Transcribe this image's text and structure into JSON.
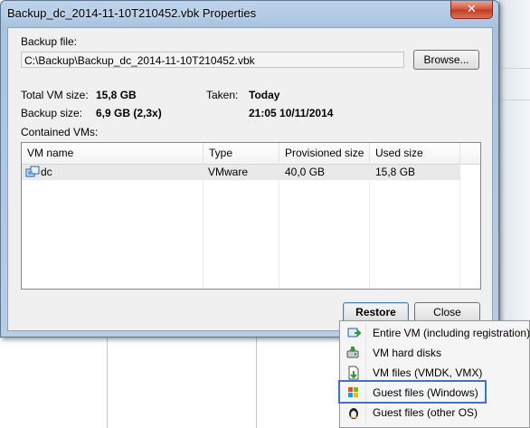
{
  "window": {
    "title": "Backup_dc_2014-11-10T210452.vbk Properties",
    "close_glyph": "✕"
  },
  "backup_file": {
    "label": "Backup file:",
    "path": "C:\\Backup\\Backup_dc_2014-11-10T210452.vbk",
    "browse_label": "Browse..."
  },
  "stats": {
    "total_vm_size_label": "Total VM size:",
    "total_vm_size_value": "15,8 GB",
    "backup_size_label": "Backup size:",
    "backup_size_value": "6,9 GB (2,3x)",
    "taken_label": "Taken:",
    "taken_day": "Today",
    "taken_time": "21:05 10/11/2014"
  },
  "contained_vms": {
    "label": "Contained VMs:",
    "columns": [
      "VM name",
      "Type",
      "Provisioned size",
      "Used size"
    ],
    "rows": [
      {
        "name": "dc",
        "type": "VMware",
        "provisioned": "40,0 GB",
        "used": "15,8 GB",
        "icon": "vm-icon"
      }
    ]
  },
  "buttons": {
    "restore": "Restore",
    "close": "Close"
  },
  "restore_menu": {
    "items": [
      {
        "label": "Entire VM (including registration)",
        "icon": "entire-vm-icon"
      },
      {
        "label": "VM hard disks",
        "icon": "hard-disk-icon"
      },
      {
        "label": "VM files (VMDK, VMX)",
        "icon": "vm-files-icon"
      },
      {
        "label": "Guest files (Windows)",
        "icon": "windows-guest-files-icon",
        "highlighted": true
      },
      {
        "label": "Guest files (other OS)",
        "icon": "linux-guest-files-icon"
      }
    ]
  },
  "colors": {
    "highlight_border": "#3c73c6",
    "title_bar": "#bcd3ea",
    "close_button": "#c23b1f"
  }
}
